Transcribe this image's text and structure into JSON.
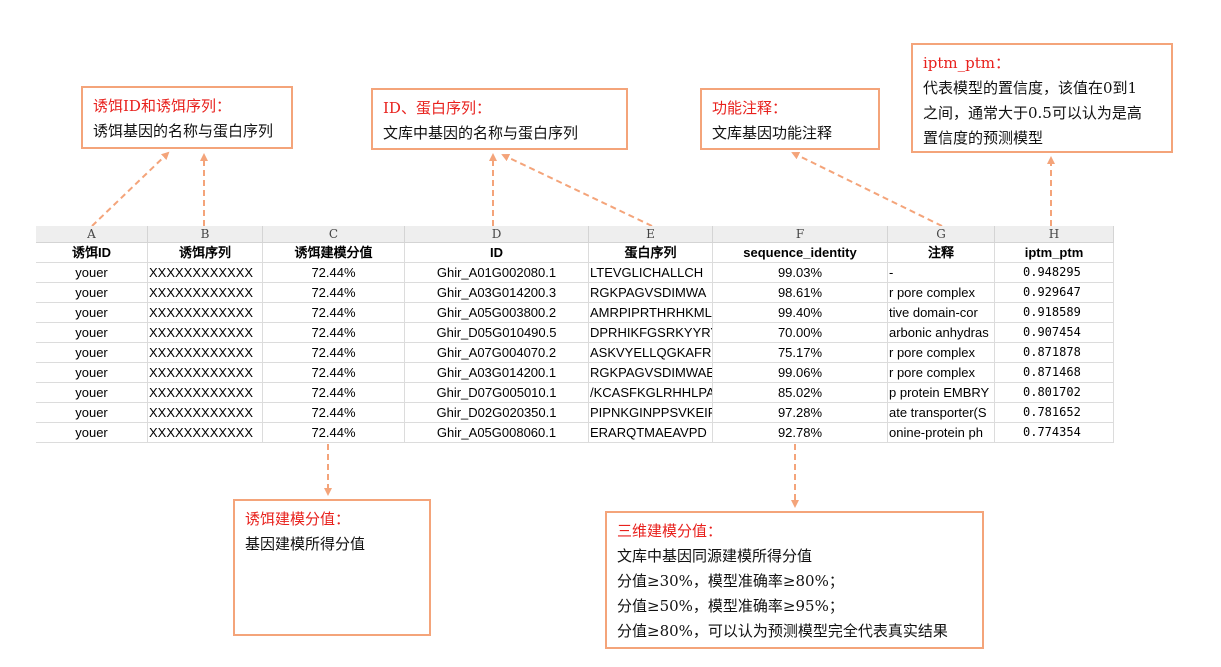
{
  "callouts": {
    "bait": {
      "title": "诱饵ID和诱饵序列：",
      "lines": [
        "诱饵基因的名称与蛋白序列"
      ]
    },
    "id_seq": {
      "title": "ID、蛋白序列：",
      "lines": [
        "文库中基因的名称与蛋白序列"
      ]
    },
    "function": {
      "title": "功能注释：",
      "lines": [
        "文库基因功能注释"
      ]
    },
    "iptm": {
      "title": "iptm_ptm：",
      "lines": [
        "代表模型的置信度，该值在0到1",
        "之间，通常大于0.5可以认为是高",
        "置信度的预测模型"
      ]
    },
    "bait_score": {
      "title": "诱饵建模分值：",
      "lines": [
        "基因建模所得分值"
      ]
    },
    "three_d": {
      "title": "三维建模分值：",
      "lines": [
        "文库中基因同源建模所得分值",
        "分值≥30%，模型准确率≥80%；",
        "分值≥50%，模型准确率≥95%；",
        "分值≥80%，可以认为预测模型完全代表真实结果"
      ]
    }
  },
  "sheet": {
    "column_letters": [
      "A",
      "B",
      "C",
      "D",
      "E",
      "F",
      "G",
      "H"
    ],
    "headers": [
      "诱饵ID",
      "诱饵序列",
      "诱饵建模分值",
      "ID",
      "蛋白序列",
      "sequence_identity",
      "注释",
      "iptm_ptm"
    ],
    "rows": [
      [
        "youer",
        "XXXXXXXXXXXX",
        "72.44%",
        "Ghir_A01G002080.1",
        "LTEVGLICHALLCH",
        "99.03%",
        "-",
        "0.948295"
      ],
      [
        "youer",
        "XXXXXXXXXXXX",
        "72.44%",
        "Ghir_A03G014200.3",
        "RGKPAGVSDIMWA",
        "98.61%",
        "r pore complex",
        "0.929647"
      ],
      [
        "youer",
        "XXXXXXXXXXXX",
        "72.44%",
        "Ghir_A05G003800.2",
        "AMRPIPRTHRHKML",
        "99.40%",
        "tive domain-cor",
        "0.918589"
      ],
      [
        "youer",
        "XXXXXXXXXXXX",
        "72.44%",
        "Ghir_D05G010490.5",
        "DPRHIKFGSRKYYRY",
        "70.00%",
        "arbonic anhydras",
        "0.907454"
      ],
      [
        "youer",
        "XXXXXXXXXXXX",
        "72.44%",
        "Ghir_A07G004070.2",
        "ASKVYELLQGKAFRS",
        "75.17%",
        "r pore complex",
        "0.871878"
      ],
      [
        "youer",
        "XXXXXXXXXXXX",
        "72.44%",
        "Ghir_A03G014200.1",
        "RGKPAGVSDIMWAE",
        "99.06%",
        "r pore complex",
        "0.871468"
      ],
      [
        "youer",
        "XXXXXXXXXXXX",
        "72.44%",
        "Ghir_D07G005010.1",
        "/KCASFKGLRHHLPA",
        "85.02%",
        "p protein EMBRY",
        "0.801702"
      ],
      [
        "youer",
        "XXXXXXXXXXXX",
        "72.44%",
        "Ghir_D02G020350.1",
        "PIPNKGINPPSVKEIF",
        "97.28%",
        "ate transporter(S",
        "0.781652"
      ],
      [
        "youer",
        "XXXXXXXXXXXX",
        "72.44%",
        "Ghir_A05G008060.1",
        "ERARQTMAEAVPD",
        "92.78%",
        "onine-protein ph",
        "0.774354"
      ]
    ]
  },
  "colors": {
    "callout_border": "#f4a47a",
    "callout_title": "#e8211d",
    "arrow": "#f4a47a"
  }
}
